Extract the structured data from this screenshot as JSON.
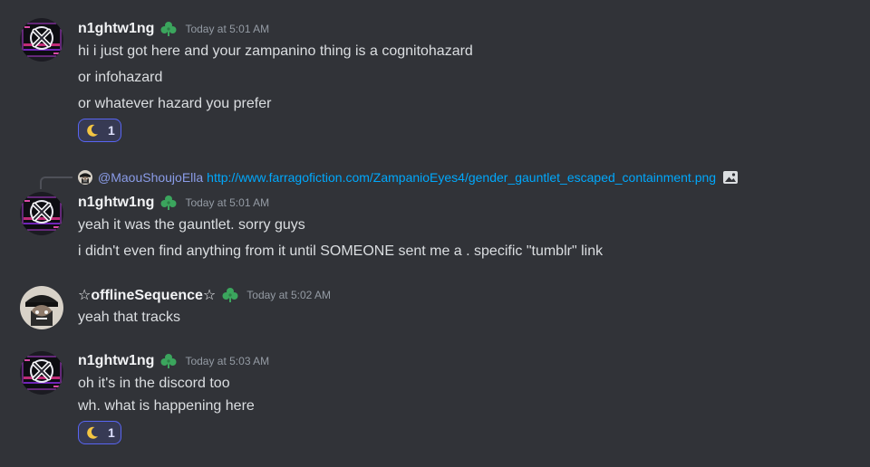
{
  "messages": [
    {
      "author": "n1ghtw1ng",
      "timestamp": "Today at 5:01 AM",
      "avatar": "nightwing-avatar",
      "lines": [
        "hi i just got here and your zampanino thing is a cognitohazard",
        "or infohazard",
        "or whatever hazard you prefer"
      ],
      "reaction": {
        "emoji": "crescent-moon-icon",
        "count": "1"
      }
    },
    {
      "reply": {
        "user": "@MaouShoujoElla",
        "link": "http://www.farragofiction.com/ZampanioEyes4/gender_gauntlet_escaped_containment.png",
        "icon": "image-icon"
      },
      "author": "n1ghtw1ng",
      "timestamp": "Today at 5:01 AM",
      "lines": [
        "yeah it was the gauntlet. sorry guys",
        "i didn't even find anything from it until SOMEONE sent me a . specific \"tumblr\" link"
      ]
    },
    {
      "author": "☆offlineSequence☆",
      "timestamp": "Today at 5:02 AM",
      "avatar": "offlinesequence-avatar",
      "lines": [
        "yeah that tracks"
      ]
    },
    {
      "author": "n1ghtw1ng",
      "timestamp": "Today at 5:03 AM",
      "lines": [
        "oh it's in the discord too",
        "wh. what is happening here"
      ],
      "reaction": {
        "emoji": "crescent-moon-icon",
        "count": "1"
      }
    }
  ],
  "colors": {
    "background": "#313338",
    "text": "#dbdee1",
    "username": "#f2f3f5",
    "timestamp": "#949ba4",
    "link": "#00a8fc",
    "role_icon": "#3ba55d",
    "reaction_border": "#5865f2",
    "reaction_bg": "#373a54",
    "moon": "#f4c542"
  }
}
